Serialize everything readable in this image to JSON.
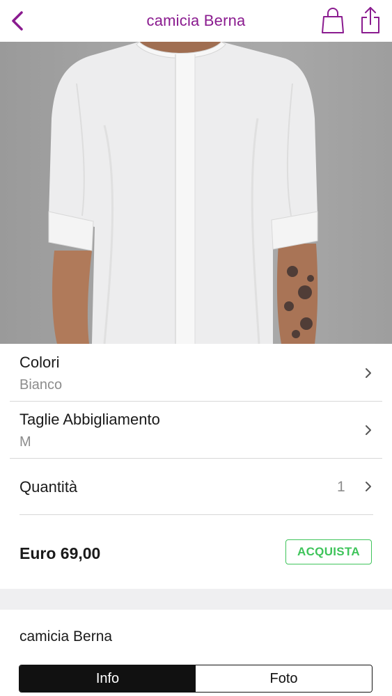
{
  "header": {
    "title": "camicia Berna"
  },
  "icons": {
    "back": "chevron-left-icon",
    "bag": "shopping-bag-icon",
    "share": "share-icon",
    "chevron": "chevron-right-icon"
  },
  "colors": {
    "accent": "#8a1b8f",
    "buy": "#3ec45a",
    "separator": "#efeff1"
  },
  "options": {
    "color": {
      "label": "Colori",
      "value": "Bianco"
    },
    "size": {
      "label": "Taglie Abbigliamento",
      "value": "M"
    },
    "quantity": {
      "label": "Quantità",
      "value": "1"
    }
  },
  "purchase": {
    "price": "Euro 69,00",
    "buy_label": "ACQUISTA"
  },
  "description": {
    "title": "camicia Berna",
    "tabs": [
      {
        "label": "Info",
        "active": true
      },
      {
        "label": "Foto",
        "active": false
      }
    ]
  }
}
